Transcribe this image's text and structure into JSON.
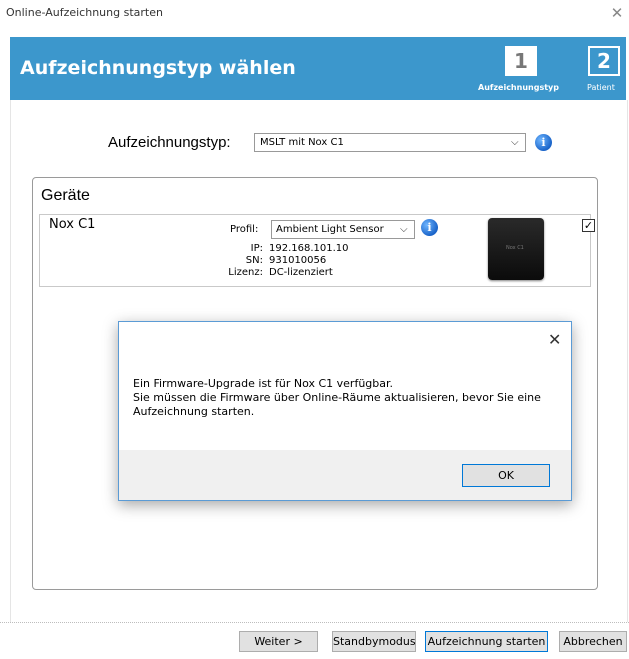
{
  "window": {
    "title": "Online-Aufzeichnung starten",
    "close_glyph": "✕"
  },
  "header": {
    "title": "Aufzeichnungstyp wählen",
    "steps": [
      {
        "number": "1",
        "label": "Aufzeichnungstyp",
        "active": true
      },
      {
        "number": "2",
        "label": "Patient",
        "active": false
      }
    ]
  },
  "recording_type": {
    "label": "Aufzeichnungstyp:",
    "value": "MSLT mit Nox C1",
    "chevron": "⌵",
    "info_glyph": "i"
  },
  "devices": {
    "title": "Geräte",
    "items": [
      {
        "name": "Nox C1",
        "profile_label": "Profil:",
        "profile_value": "Ambient Light Sensor",
        "ip_label": "IP:",
        "ip_value": "192.168.101.10",
        "sn_label": "SN:",
        "sn_value": "931010056",
        "license_label": "Lizenz:",
        "license_value": "DC-lizenziert",
        "image_text": "Nox C1",
        "checked": true,
        "check_glyph": "✓"
      }
    ]
  },
  "dialog": {
    "close_glyph": "✕",
    "message_lines": [
      "Ein Firmware-Upgrade ist für Nox C1 verfügbar.",
      "Sie müssen die Firmware über Online-Räume aktualisieren, bevor Sie eine",
      "Aufzeichnung starten."
    ],
    "ok_label": "OK"
  },
  "footer": {
    "next_label": "Weiter >",
    "standby_label": "Standbymodus",
    "start_label": "Aufzeichnung starten",
    "cancel_label": "Abbrechen"
  },
  "colors": {
    "header_blue": "#3c97cc",
    "focus_blue": "#0078d7"
  }
}
